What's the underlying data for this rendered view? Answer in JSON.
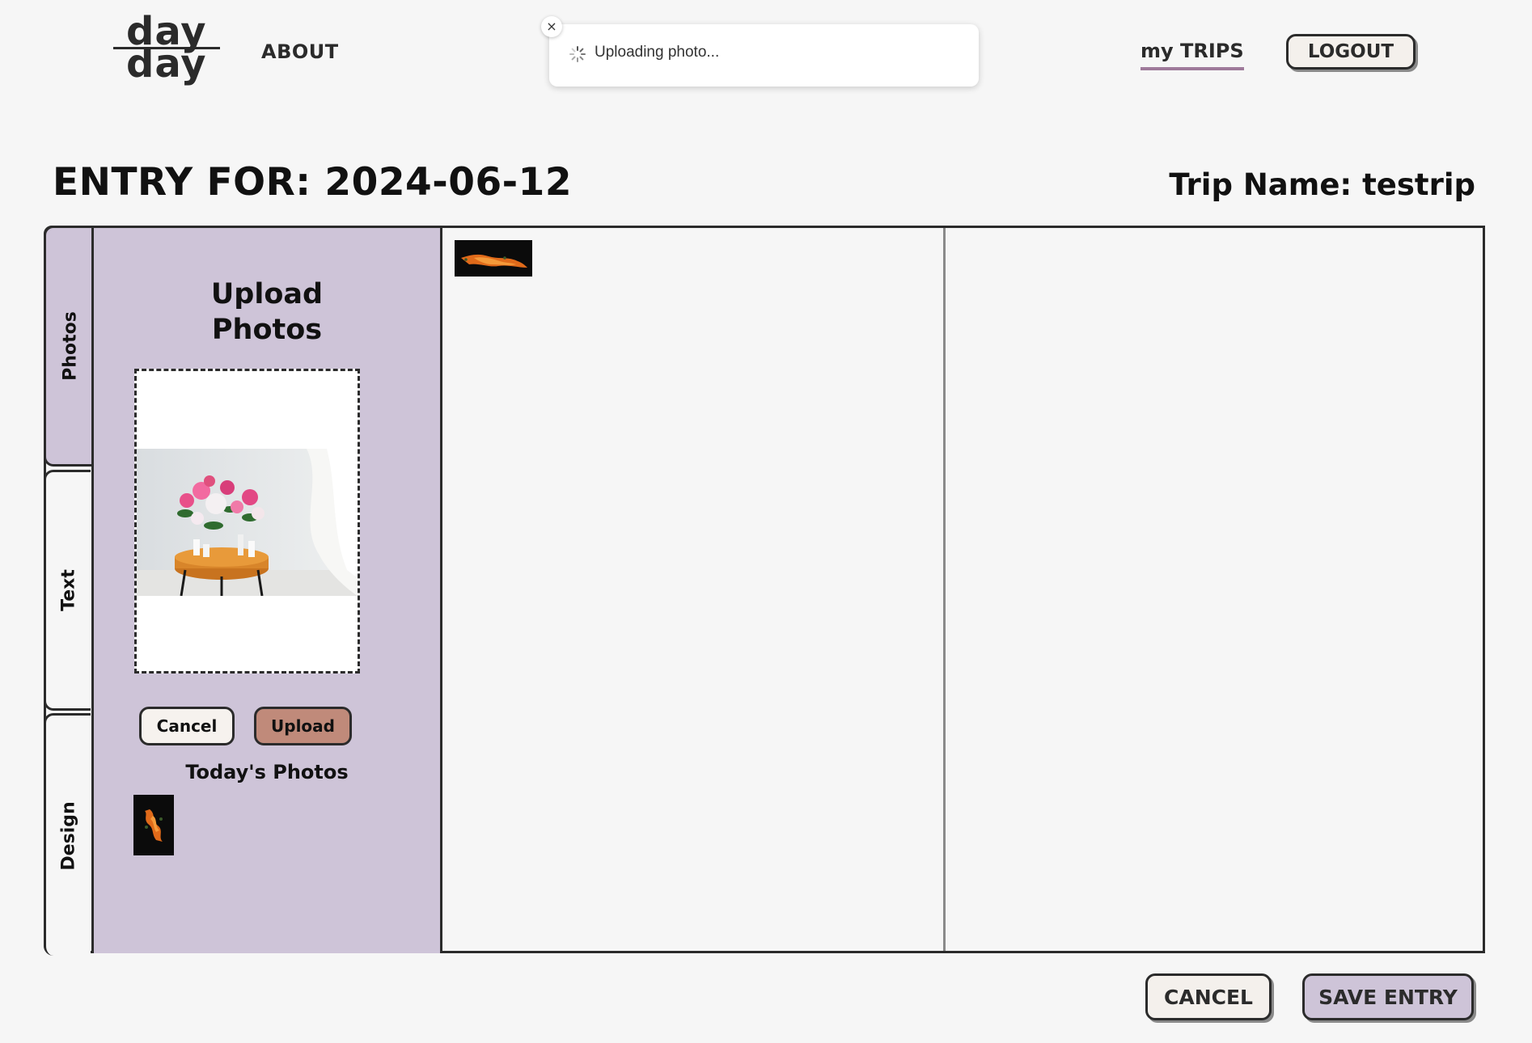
{
  "header": {
    "logo_top": "day",
    "logo_bottom": "day",
    "nav_about": "ABOUT",
    "nav_trips": "my TRIPS",
    "logout_label": "LOGOUT"
  },
  "toast": {
    "close_glyph": "×",
    "message": "Uploading photo..."
  },
  "page": {
    "entry_title": "ENTRY FOR: 2024-06-12",
    "trip_name": "Trip Name: testrip"
  },
  "tabs": [
    {
      "label": "Photos",
      "active": true
    },
    {
      "label": "Text",
      "active": false
    },
    {
      "label": "Design",
      "active": false
    }
  ],
  "upload_panel": {
    "title_line1": "Upload",
    "title_line2": "Photos",
    "cancel_label": "Cancel",
    "upload_label": "Upload",
    "todays_photos_title": "Today's Photos"
  },
  "footer": {
    "cancel_label": "CANCEL",
    "save_label": "SAVE ENTRY"
  },
  "colors": {
    "panel_bg": "#cec4d8",
    "upload_button": "#c08a7a",
    "nav_underline": "#9e7a9a",
    "page_bg": "#f6f6f6"
  }
}
